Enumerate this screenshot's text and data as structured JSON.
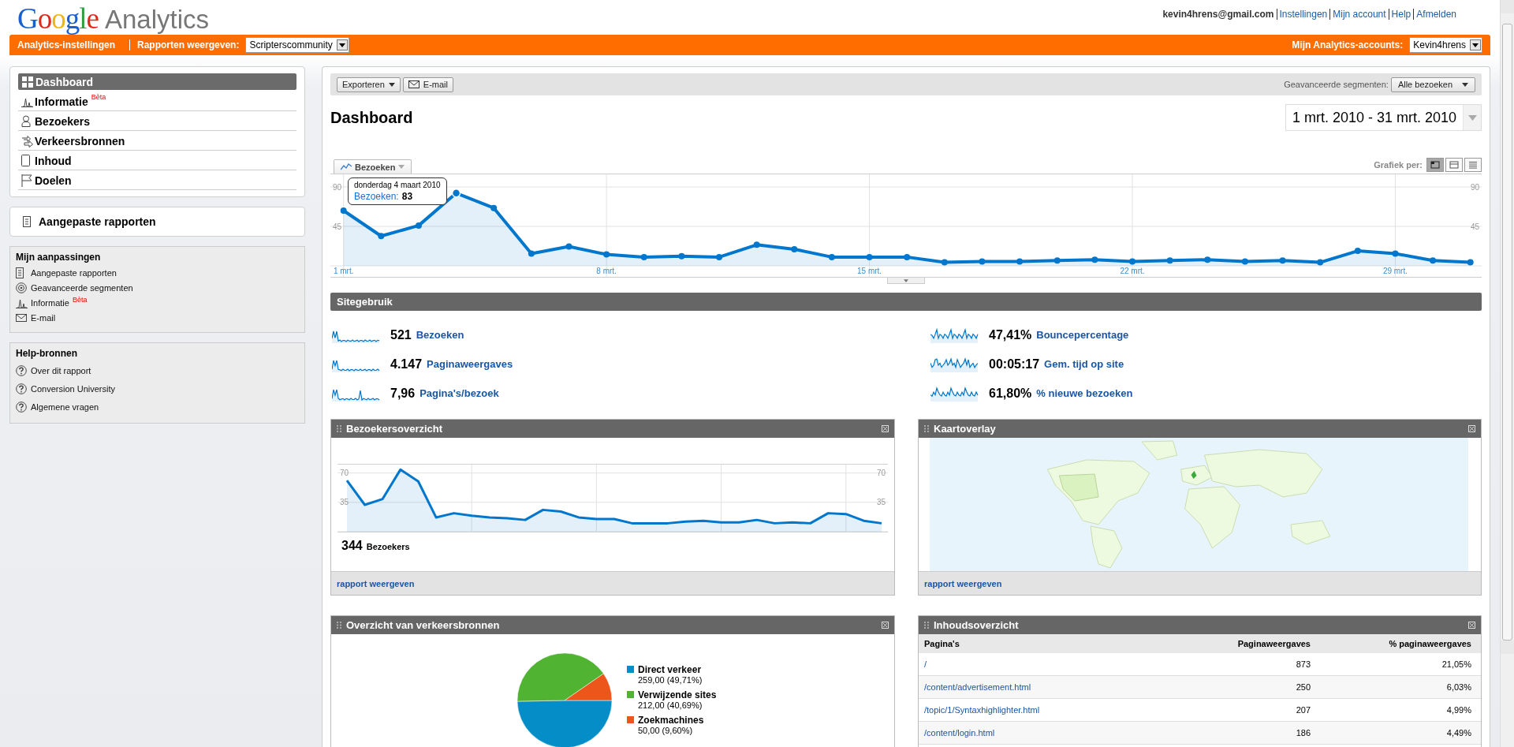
{
  "header": {
    "logo": "Google",
    "product": "Analytics",
    "user": "kevin4hrens@gmail.com",
    "links": [
      "Instellingen",
      "Mijn account",
      "Help",
      "Afmelden"
    ]
  },
  "orange_bar": {
    "settings_link": "Analytics-instellingen",
    "report_label": "Rapporten weergeven:",
    "report_select": "Scripterscommunity",
    "accounts_label": "Mijn Analytics-accounts:",
    "accounts_select": "Kevin4hrens"
  },
  "sidebar": {
    "nav": [
      {
        "label": "Dashboard",
        "selected": true
      },
      {
        "label": "Informatie",
        "badge": "Bèta",
        "selected": false
      },
      {
        "label": "Bezoekers",
        "selected": false
      },
      {
        "label": "Verkeersbronnen",
        "selected": false
      },
      {
        "label": "Inhoud",
        "selected": false
      },
      {
        "label": "Doelen",
        "selected": false
      }
    ],
    "custom_reports": "Aangepaste rapporten",
    "customizations": {
      "title": "Mijn aanpassingen",
      "items": [
        {
          "label": "Aangepaste rapporten"
        },
        {
          "label": "Geavanceerde segmenten"
        },
        {
          "label": "Informatie",
          "badge": "Bèta"
        },
        {
          "label": "E-mail"
        }
      ]
    },
    "help": {
      "title": "Help-bronnen",
      "items": [
        "Over dit rapport",
        "Conversion University",
        "Algemene vragen"
      ]
    }
  },
  "toolbar": {
    "buttons": [
      "Exporteren",
      "E-mail"
    ],
    "segments_label": "Geavanceerde segmenten:",
    "segments_select": "Alle bezoeken"
  },
  "title": "Dashboard",
  "date_range": "1 mrt. 2010 - 31 mrt. 2010",
  "main_chart": {
    "view_label": "Grafiek per:",
    "views": [
      {
        "selected": true
      },
      {
        "selected": false
      },
      {
        "selected": false
      }
    ],
    "tooltip": {
      "date": "donderdag 4 maart 2010",
      "label": "Bezoeken:",
      "value": "83"
    },
    "right_axis_ticks": [
      "90",
      "45"
    ],
    "chart_data": {
      "type": "area",
      "x": [
        1,
        2,
        3,
        4,
        5,
        6,
        7,
        8,
        9,
        10,
        11,
        12,
        13,
        14,
        15,
        16,
        17,
        18,
        19,
        20,
        21,
        22,
        23,
        24,
        25,
        26,
        27,
        28,
        29,
        30,
        31
      ],
      "xlim": [
        0.65,
        31.3
      ],
      "ylim": [
        -12.6,
        104.4
      ],
      "yticks": [
        45,
        90
      ],
      "grid": true,
      "xticks": [
        {
          "value": 1,
          "label": "1 mrt."
        },
        {
          "value": 8,
          "label": "8 mrt."
        },
        {
          "value": 15,
          "label": "15 mrt."
        },
        {
          "value": 22,
          "label": "22 mrt."
        },
        {
          "value": 29,
          "label": "29 mrt."
        }
      ],
      "series": [
        {
          "name": "Bezoeken",
          "color": "#0077cc",
          "values": [
            63,
            34,
            46,
            83,
            66,
            14,
            22,
            13,
            10,
            11,
            10,
            24,
            19,
            10,
            10,
            10,
            4,
            5,
            5,
            6,
            7,
            5,
            6,
            7,
            5,
            6,
            4,
            17,
            14,
            6,
            4
          ]
        }
      ]
    }
  },
  "site_usage": {
    "title": "Sitegebruik",
    "metrics": [
      {
        "value": "521",
        "label": "Bezoeken"
      },
      {
        "value": "4.147",
        "label": "Paginaweergaves"
      },
      {
        "value": "7,96",
        "label": "Pagina's/bezoek"
      },
      {
        "value": "47,41%",
        "label": "Bouncepercentage"
      },
      {
        "value": "00:05:17",
        "label": "Gem. tijd op site"
      },
      {
        "value": "61,80%",
        "label": "% nieuwe bezoeken"
      }
    ]
  },
  "widgets": [
    {
      "kind": "line",
      "title": "Bezoekersoverzicht",
      "total": "344",
      "footer_link": "rapport weergeven",
      "right_axis_ticks": [
        "70",
        "35"
      ],
      "chart_data": {
        "type": "area",
        "ylim": [
          0,
          80
        ],
        "yticks": [
          35,
          70
        ],
        "grid": true,
        "series": [
          {
            "name": "Bezoekers",
            "color": "#0077cc",
            "values": [
              61,
              32,
              39,
              74,
              60,
              17,
              22,
              19,
              17,
              16,
              14,
              26,
              24,
              17,
              15,
              15,
              10,
              10,
              10,
              12,
              13,
              11,
              11,
              14,
              10,
              11,
              10,
              22,
              21,
              13,
              10
            ]
          }
        ]
      }
    },
    {
      "kind": "map",
      "title": "Kaartoverlay",
      "footer_link": "rapport weergeven"
    },
    {
      "kind": "pie",
      "title": "Overzicht van verkeersbronnen",
      "chart_data": {
        "type": "pie",
        "categories": [
          "Direct verkeer",
          "Verwijzende sites",
          "Zoekmachines"
        ],
        "values": [
          49.71,
          40.69,
          9.6
        ]
      },
      "legend": [
        {
          "detail": "259,00 (49,71%)",
          "color": "#058dc7"
        },
        {
          "detail": "212,00 (40,69%)",
          "color": "#50b432"
        },
        {
          "detail": "50,00 (9,60%)",
          "color": "#ed561b"
        }
      ]
    },
    {
      "kind": "table",
      "title": "Inhoudsoverzicht",
      "columns": [
        "Pagina's",
        "Paginaweergaves",
        "% paginaweergaves"
      ],
      "rows": [
        [
          "/",
          "873",
          "21,05%"
        ],
        [
          "/content/advertisement.html",
          "250",
          "6,03%"
        ],
        [
          "/topic/1/Syntaxhighlighter.html",
          "207",
          "4,99%"
        ],
        [
          "/content/login.html",
          "186",
          "4,49%"
        ]
      ]
    }
  ]
}
